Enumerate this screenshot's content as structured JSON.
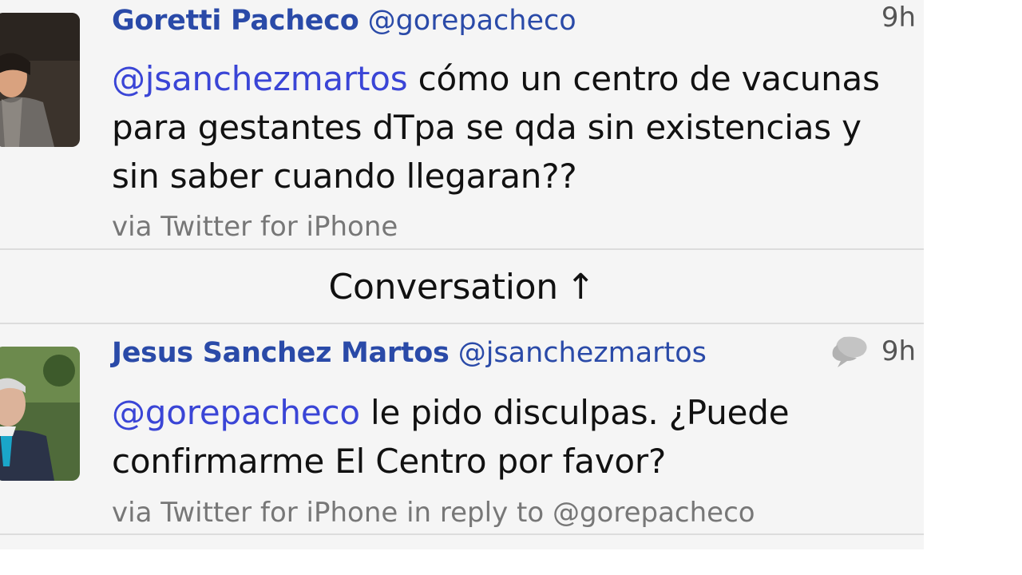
{
  "tweets": [
    {
      "name": "Goretti Pacheco",
      "handle": "@gorepacheco",
      "time": "9h",
      "mention": "@jsanchezmartos",
      "text": " cómo un centro de vacunas para gestantes dTpa se qda sin existencias y sin saber cuando llegaran??",
      "via": "via Twitter for iPhone"
    },
    {
      "name": "Jesus Sanchez Martos",
      "handle": "@jsanchezmartos",
      "time": "9h",
      "mention": "@gorepacheco",
      "text": " le pido disculpas. ¿Puede confirmarme El Centro por favor?",
      "via": "via Twitter for iPhone in reply to @gorepacheco"
    }
  ],
  "conversation": {
    "label": "Conversation",
    "arrow": "↑"
  },
  "icons": {
    "reply": "conversation-bubbles-icon"
  },
  "colors": {
    "name": "#2a4aa8",
    "mention": "#3a45d6"
  }
}
